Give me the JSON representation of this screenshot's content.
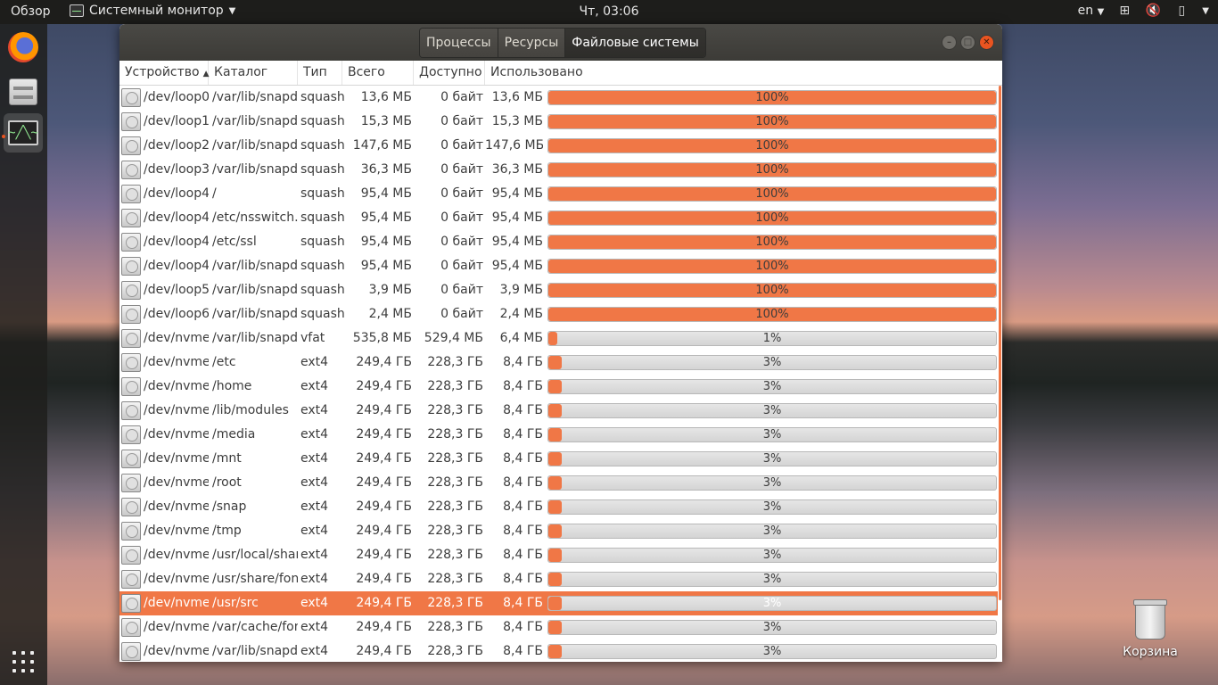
{
  "topbar": {
    "activities": "Обзор",
    "app_name": "Системный монитор",
    "clock": "Чт, 03:06",
    "lang": "en"
  },
  "dock": {
    "items": [
      "firefox-icon",
      "files-icon",
      "system-monitor-icon"
    ],
    "monitor_glyph": "~╱╲~"
  },
  "desktop": {
    "trash_label": "Корзина"
  },
  "window": {
    "tabs": [
      "Процессы",
      "Ресурсы",
      "Файловые системы"
    ],
    "active_tab": 2,
    "columns": [
      "Устройство",
      "Каталог",
      "Тип",
      "Всего",
      "Доступно",
      "Использовано"
    ],
    "sort_indicator": "▲",
    "accent_color": "#f07746",
    "selected_row": 21,
    "rows": [
      {
        "device": "/dev/loop0",
        "mount": "/var/lib/snapd",
        "type": "squashfs",
        "total": "13,6 МБ",
        "avail": "0 байт",
        "used": "13,6 МБ",
        "pct_text": "100%",
        "pct": 100
      },
      {
        "device": "/dev/loop1",
        "mount": "/var/lib/snapd",
        "type": "squashfs",
        "total": "15,3 МБ",
        "avail": "0 байт",
        "used": "15,3 МБ",
        "pct_text": "100%",
        "pct": 100
      },
      {
        "device": "/dev/loop2",
        "mount": "/var/lib/snapd",
        "type": "squashfs",
        "total": "147,6 МБ",
        "avail": "0 байт",
        "used": "147,6 МБ",
        "pct_text": "100%",
        "pct": 100
      },
      {
        "device": "/dev/loop3",
        "mount": "/var/lib/snapd",
        "type": "squashfs",
        "total": "36,3 МБ",
        "avail": "0 байт",
        "used": "36,3 МБ",
        "pct_text": "100%",
        "pct": 100
      },
      {
        "device": "/dev/loop4",
        "mount": "/",
        "type": "squashfs",
        "total": "95,4 МБ",
        "avail": "0 байт",
        "used": "95,4 МБ",
        "pct_text": "100%",
        "pct": 100
      },
      {
        "device": "/dev/loop4",
        "mount": "/etc/nsswitch.conf",
        "type": "squashfs",
        "total": "95,4 МБ",
        "avail": "0 байт",
        "used": "95,4 МБ",
        "pct_text": "100%",
        "pct": 100
      },
      {
        "device": "/dev/loop4",
        "mount": "/etc/ssl",
        "type": "squashfs",
        "total": "95,4 МБ",
        "avail": "0 байт",
        "used": "95,4 МБ",
        "pct_text": "100%",
        "pct": 100
      },
      {
        "device": "/dev/loop4",
        "mount": "/var/lib/snapd",
        "type": "squashfs",
        "total": "95,4 МБ",
        "avail": "0 байт",
        "used": "95,4 МБ",
        "pct_text": "100%",
        "pct": 100
      },
      {
        "device": "/dev/loop5",
        "mount": "/var/lib/snapd",
        "type": "squashfs",
        "total": "3,9 МБ",
        "avail": "0 байт",
        "used": "3,9 МБ",
        "pct_text": "100%",
        "pct": 100
      },
      {
        "device": "/dev/loop6",
        "mount": "/var/lib/snapd",
        "type": "squashfs",
        "total": "2,4 МБ",
        "avail": "0 байт",
        "used": "2,4 МБ",
        "pct_text": "100%",
        "pct": 100
      },
      {
        "device": "/dev/nvme",
        "mount": "/var/lib/snapd",
        "type": "vfat",
        "total": "535,8 МБ",
        "avail": "529,4 МБ",
        "used": "6,4 МБ",
        "pct_text": "1%",
        "pct": 1
      },
      {
        "device": "/dev/nvme",
        "mount": "/etc",
        "type": "ext4",
        "total": "249,4 ГБ",
        "avail": "228,3 ГБ",
        "used": "8,4 ГБ",
        "pct_text": "3%",
        "pct": 3
      },
      {
        "device": "/dev/nvme",
        "mount": "/home",
        "type": "ext4",
        "total": "249,4 ГБ",
        "avail": "228,3 ГБ",
        "used": "8,4 ГБ",
        "pct_text": "3%",
        "pct": 3
      },
      {
        "device": "/dev/nvme",
        "mount": "/lib/modules",
        "type": "ext4",
        "total": "249,4 ГБ",
        "avail": "228,3 ГБ",
        "used": "8,4 ГБ",
        "pct_text": "3%",
        "pct": 3
      },
      {
        "device": "/dev/nvme",
        "mount": "/media",
        "type": "ext4",
        "total": "249,4 ГБ",
        "avail": "228,3 ГБ",
        "used": "8,4 ГБ",
        "pct_text": "3%",
        "pct": 3
      },
      {
        "device": "/dev/nvme",
        "mount": "/mnt",
        "type": "ext4",
        "total": "249,4 ГБ",
        "avail": "228,3 ГБ",
        "used": "8,4 ГБ",
        "pct_text": "3%",
        "pct": 3
      },
      {
        "device": "/dev/nvme",
        "mount": "/root",
        "type": "ext4",
        "total": "249,4 ГБ",
        "avail": "228,3 ГБ",
        "used": "8,4 ГБ",
        "pct_text": "3%",
        "pct": 3
      },
      {
        "device": "/dev/nvme",
        "mount": "/snap",
        "type": "ext4",
        "total": "249,4 ГБ",
        "avail": "228,3 ГБ",
        "used": "8,4 ГБ",
        "pct_text": "3%",
        "pct": 3
      },
      {
        "device": "/dev/nvme",
        "mount": "/tmp",
        "type": "ext4",
        "total": "249,4 ГБ",
        "avail": "228,3 ГБ",
        "used": "8,4 ГБ",
        "pct_text": "3%",
        "pct": 3
      },
      {
        "device": "/dev/nvme",
        "mount": "/usr/local/share",
        "type": "ext4",
        "total": "249,4 ГБ",
        "avail": "228,3 ГБ",
        "used": "8,4 ГБ",
        "pct_text": "3%",
        "pct": 3
      },
      {
        "device": "/dev/nvme",
        "mount": "/usr/share/fonts",
        "type": "ext4",
        "total": "249,4 ГБ",
        "avail": "228,3 ГБ",
        "used": "8,4 ГБ",
        "pct_text": "3%",
        "pct": 3
      },
      {
        "device": "/dev/nvme",
        "mount": "/usr/src",
        "type": "ext4",
        "total": "249,4 ГБ",
        "avail": "228,3 ГБ",
        "used": "8,4 ГБ",
        "pct_text": "3%",
        "pct": 3
      },
      {
        "device": "/dev/nvme",
        "mount": "/var/cache/fontconfig",
        "type": "ext4",
        "total": "249,4 ГБ",
        "avail": "228,3 ГБ",
        "used": "8,4 ГБ",
        "pct_text": "3%",
        "pct": 3
      },
      {
        "device": "/dev/nvme",
        "mount": "/var/lib/snapd",
        "type": "ext4",
        "total": "249,4 ГБ",
        "avail": "228,3 ГБ",
        "used": "8,4 ГБ",
        "pct_text": "3%",
        "pct": 3
      }
    ]
  }
}
